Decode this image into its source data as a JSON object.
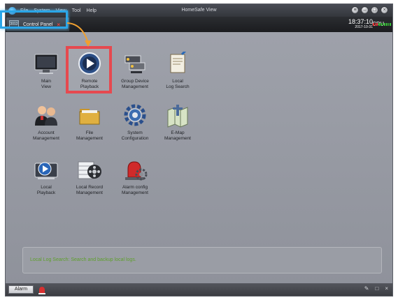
{
  "menu": {
    "items": [
      "File",
      "System",
      "View",
      "Tool",
      "Help"
    ],
    "window_title": "HomeSafe View",
    "window_controls": [
      "menu-icon",
      "minimize-icon",
      "maximize-icon",
      "close-icon"
    ]
  },
  "tab": {
    "label": "Control Panel",
    "close": "×",
    "icon_text": "2012"
  },
  "clock": {
    "time": "18:37:10",
    "date": "2017-10-31"
  },
  "cpu": {
    "label": "CPU",
    "segments": 10,
    "hot_segments": 3
  },
  "tiles": [
    {
      "line1": "Main",
      "line2": "View",
      "icon": "monitor-icon"
    },
    {
      "line1": "Remote",
      "line2": "Playback",
      "icon": "remote-playback-icon"
    },
    {
      "line1": "Group Device",
      "line2": "Management",
      "icon": "device-group-icon"
    },
    {
      "line1": "Local",
      "line2": "Log Search",
      "icon": "log-search-icon"
    },
    {
      "line1": "Account",
      "line2": "Management",
      "icon": "users-icon"
    },
    {
      "line1": "File",
      "line2": "Management",
      "icon": "folder-icon"
    },
    {
      "line1": "System",
      "line2": "Configuration",
      "icon": "gear-icon"
    },
    {
      "line1": "E-Map",
      "line2": "Management",
      "icon": "map-icon"
    },
    {
      "line1": "Local",
      "line2": "Playback",
      "icon": "local-playback-icon"
    },
    {
      "line1": "Local Record",
      "line2": "Management",
      "icon": "film-reel-icon"
    },
    {
      "line1": "Alarm config",
      "line2": "Management",
      "icon": "alarm-config-icon"
    }
  ],
  "status_message": "Local Log Search: Search and backup local logs.",
  "statusbar": {
    "alarm_label": "Alarm",
    "right_icons": [
      "pin-icon",
      "window-icon",
      "close-icon"
    ],
    "right_glyphs": [
      "✎",
      "□",
      "×"
    ]
  },
  "colors": {
    "highlight_blue": "#2aa6e8",
    "highlight_red": "#e6494f",
    "arrow_orange": "#f0a030",
    "status_text": "#5e9f2c"
  }
}
